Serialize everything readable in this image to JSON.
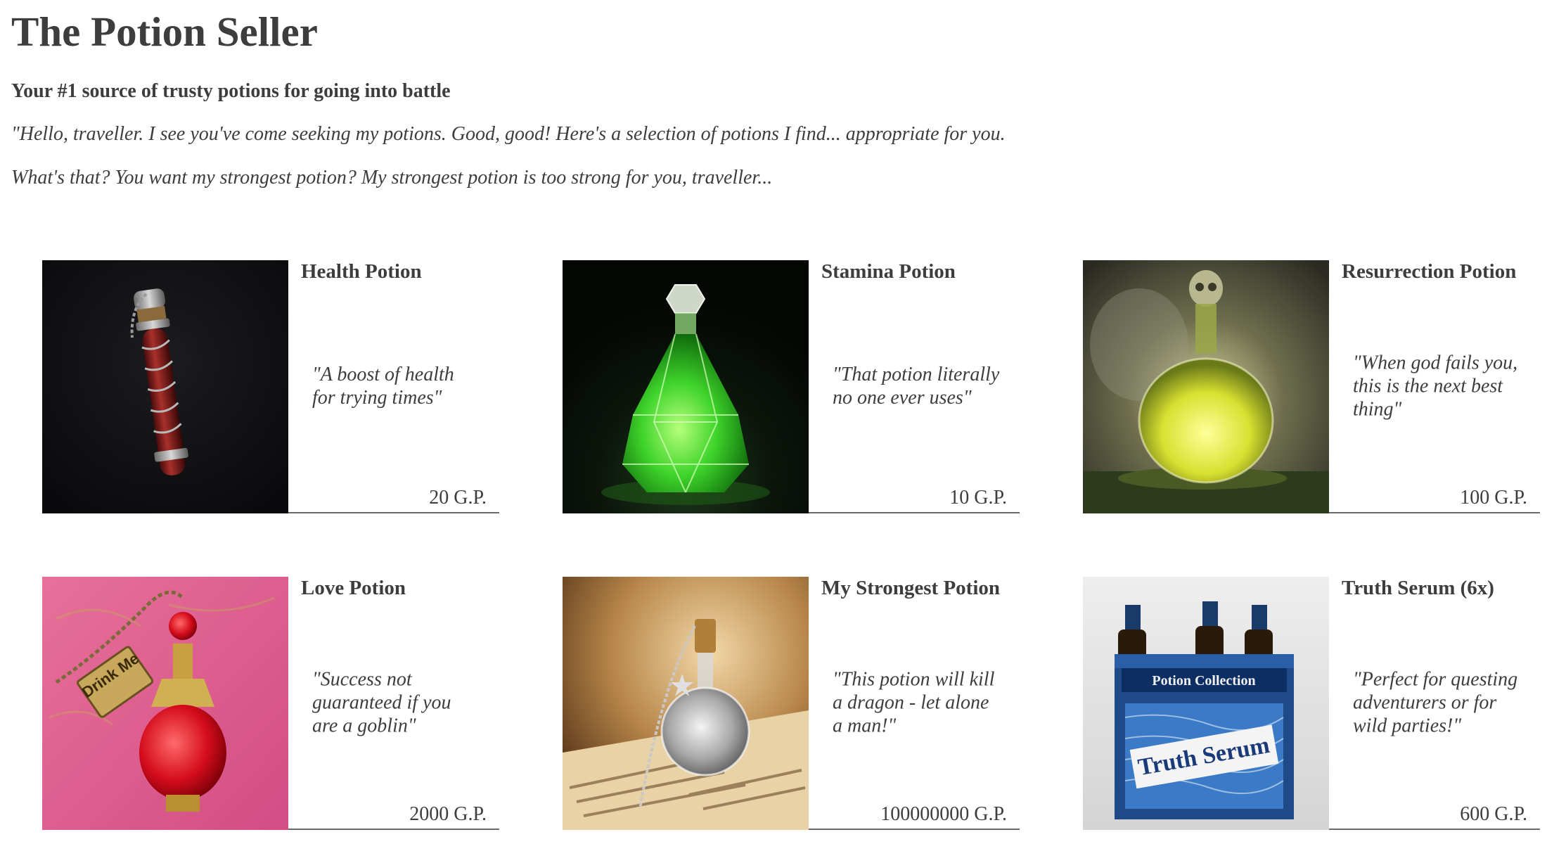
{
  "header": {
    "title": "The Potion Seller",
    "subtitle": "Your #1 source of trusty potions for going into battle",
    "intro_line_1": "\"Hello, traveller. I see you've come seeking my potions. Good, good! Here's a selection of potions I find... appropriate for you.",
    "intro_line_2": "What's that? You want my strongest potion? My strongest potion is too strong for you, traveller..."
  },
  "products": [
    {
      "name": "Health Potion",
      "description": "\"A boost of health for trying times\"",
      "price": "20 G.P.",
      "image_icon": "red-vial-icon"
    },
    {
      "name": "Stamina Potion",
      "description": "\"That potion literally no one ever uses\"",
      "price": "10 G.P.",
      "image_icon": "green-crystal-bottle-icon"
    },
    {
      "name": "Resurrection Potion",
      "description": "\"When god fails you, this is the next best thing\"",
      "price": "100 G.P.",
      "image_icon": "skull-flask-icon"
    },
    {
      "name": "Love Potion",
      "description": "\"Success not guaranteed if you are a goblin\"",
      "price": "2000 G.P.",
      "image_icon": "drink-me-bottle-icon",
      "image_tag_text": "Drink Me"
    },
    {
      "name": "My Strongest Potion",
      "description": "\"This potion will kill a dragon - let alone a man!\"",
      "price": "100000000 G.P.",
      "image_icon": "glitter-vial-icon"
    },
    {
      "name": "Truth Serum (6x)",
      "description": "\"Perfect for questing adventurers or for wild parties!\"",
      "price": "600 G.P.",
      "image_icon": "six-pack-icon",
      "image_box_label": "Potion Collection",
      "image_box_brand": "Truth Serum"
    }
  ]
}
